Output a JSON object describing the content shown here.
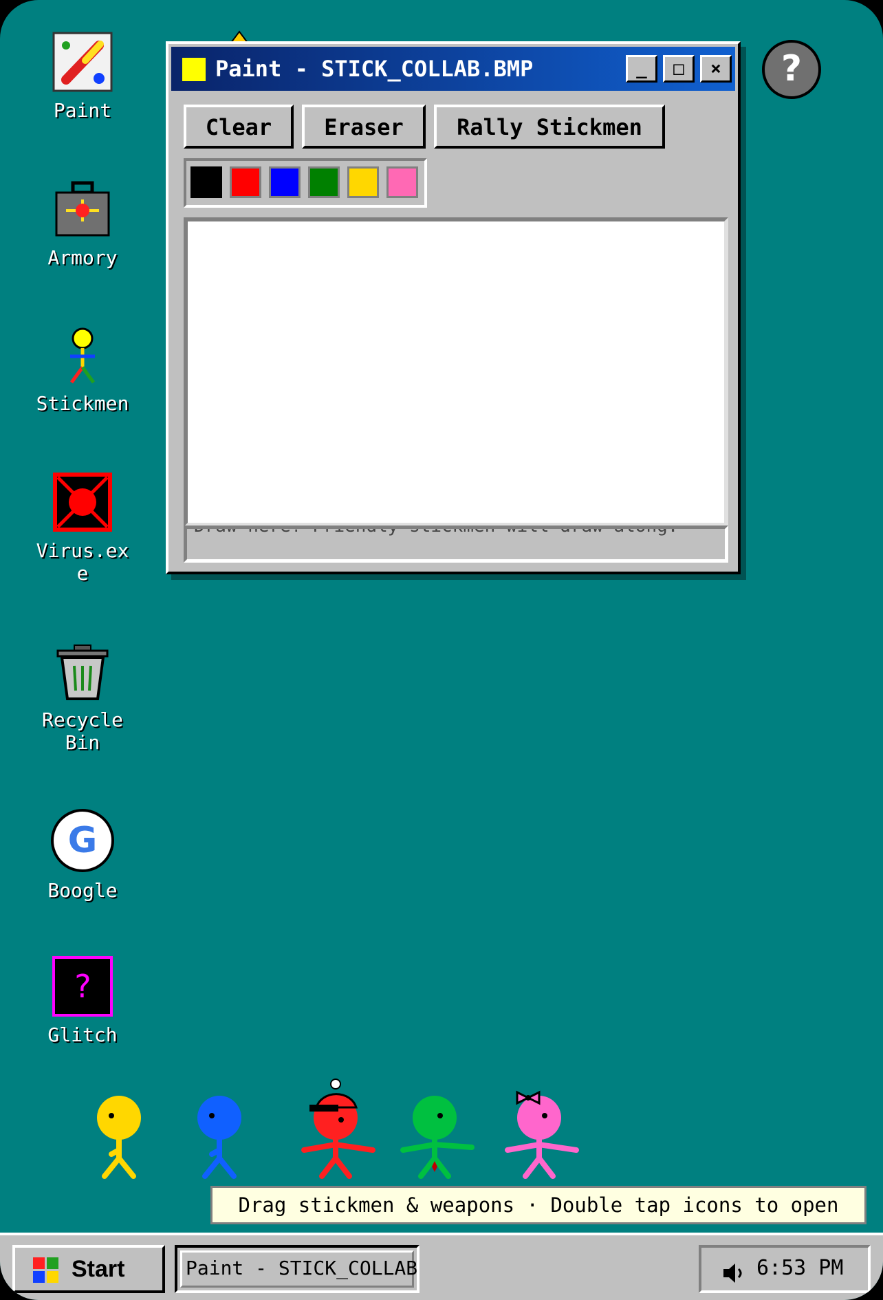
{
  "desktop": {
    "icons": [
      {
        "label": "Paint"
      },
      {
        "label": "Armory"
      },
      {
        "label": "Stickmen"
      },
      {
        "label": "Virus.exe"
      },
      {
        "label": "Recycle Bin"
      },
      {
        "label": "Boogle",
        "glyph_text": "G"
      },
      {
        "label": "Glitch",
        "glyph_text": "?"
      }
    ],
    "help_label": "?",
    "hint": "Drag stickmen & weapons · Double tap icons to open"
  },
  "window": {
    "title": "Paint - STICK_COLLAB.BMP",
    "controls": {
      "minimize": "_",
      "maximize": "□",
      "close": "×"
    },
    "toolbar": {
      "clear": "Clear",
      "eraser": "Eraser",
      "rally": "Rally Stickmen"
    },
    "palette": [
      "#000000",
      "#ff0000",
      "#0000ff",
      "#008000",
      "#ffd700",
      "#ff69b4"
    ],
    "selected_color": "#000000",
    "status": "Draw here! Friendly stickmen will draw along."
  },
  "stickmen": [
    {
      "color": "#ffd700",
      "accessory": "none"
    },
    {
      "color": "#1060ff",
      "accessory": "none"
    },
    {
      "color": "#ff2020",
      "accessory": "cap"
    },
    {
      "color": "#00c040",
      "accessory": "none"
    },
    {
      "color": "#ff66cc",
      "accessory": "bow"
    }
  ],
  "taskbar": {
    "start": "Start",
    "task": "Paint - STICK_COLLAB.BMP",
    "time": "6:53 PM"
  }
}
